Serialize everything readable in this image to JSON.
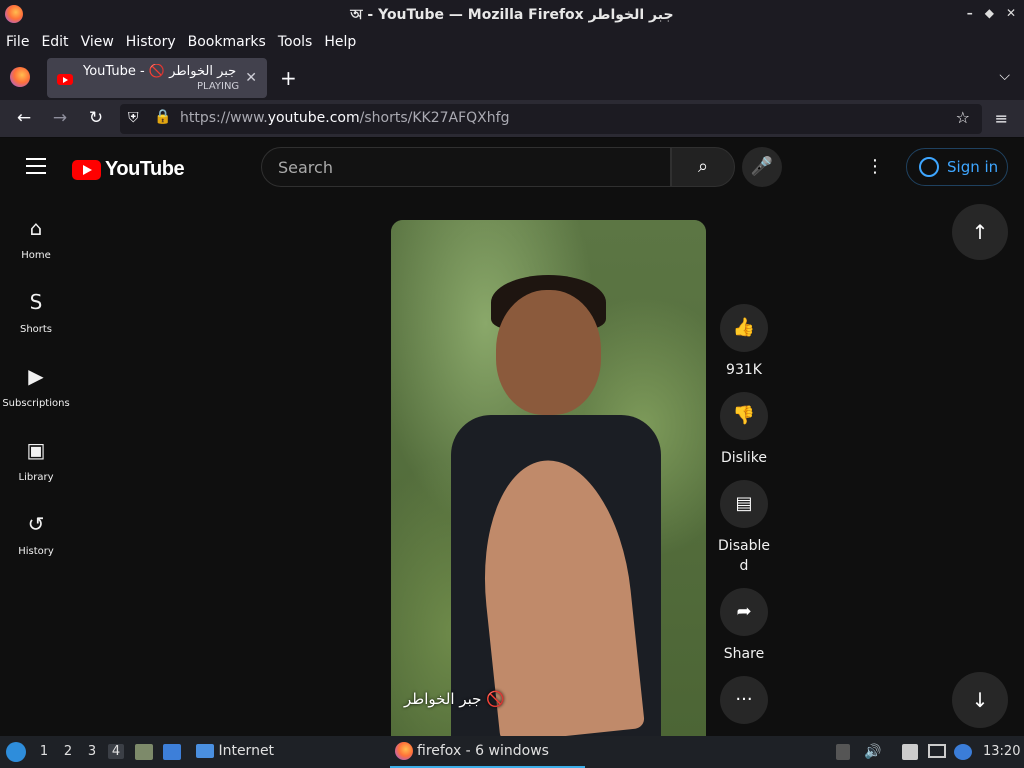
{
  "window": {
    "title": "অ - YouTube — Mozilla Firefox جبر الخواطر",
    "min": "–",
    "restore": "◆",
    "close": "✕"
  },
  "menubar": [
    "File",
    "Edit",
    "View",
    "History",
    "Bookmarks",
    "Tools",
    "Help"
  ],
  "tab": {
    "title": "YouTube - 🚫 جبر الخواطر",
    "status": "PLAYING",
    "close": "✕"
  },
  "newtab": "+",
  "tablist": "⌵",
  "nav": {
    "back": "←",
    "forward": "→",
    "reload": "↻",
    "url_prefix": "https://www.",
    "url_domain": "youtube.com",
    "url_path": "/shorts/KK27AFQXhfg",
    "shield": "⛨",
    "lock": "🔒",
    "bookmark": "☆",
    "menu": "≡"
  },
  "youtube": {
    "logo_text": "YouTube",
    "search_placeholder": "Search",
    "search_icon": "⌕",
    "mic_icon": "🎤",
    "more_icon": "⋮",
    "signin_label": "Sign in"
  },
  "sidebar": [
    {
      "label": "Home",
      "icon": "⌂"
    },
    {
      "label": "Shorts",
      "icon": "S"
    },
    {
      "label": "Subscriptions",
      "icon": "▶"
    },
    {
      "label": "Library",
      "icon": "▣"
    },
    {
      "label": "History",
      "icon": "↺"
    }
  ],
  "video": {
    "caption": "جبر الخواطر 🚫"
  },
  "actions": {
    "like": {
      "icon": "👍",
      "label": "931K"
    },
    "dislike": {
      "icon": "👎",
      "label": "Dislike"
    },
    "comments": {
      "icon": "▤",
      "label": "Disabled"
    },
    "share": {
      "icon": "➦",
      "label": "Share"
    },
    "more": {
      "icon": "···"
    }
  },
  "nav_arrows": {
    "up": "↑",
    "down": "↓"
  },
  "taskbar": {
    "workspaces": [
      "1",
      "2",
      "3",
      "4"
    ],
    "active_workspace": "4",
    "internet_label": "Internet",
    "firefox_label": "firefox - 6 windows",
    "clock": "13:20"
  }
}
